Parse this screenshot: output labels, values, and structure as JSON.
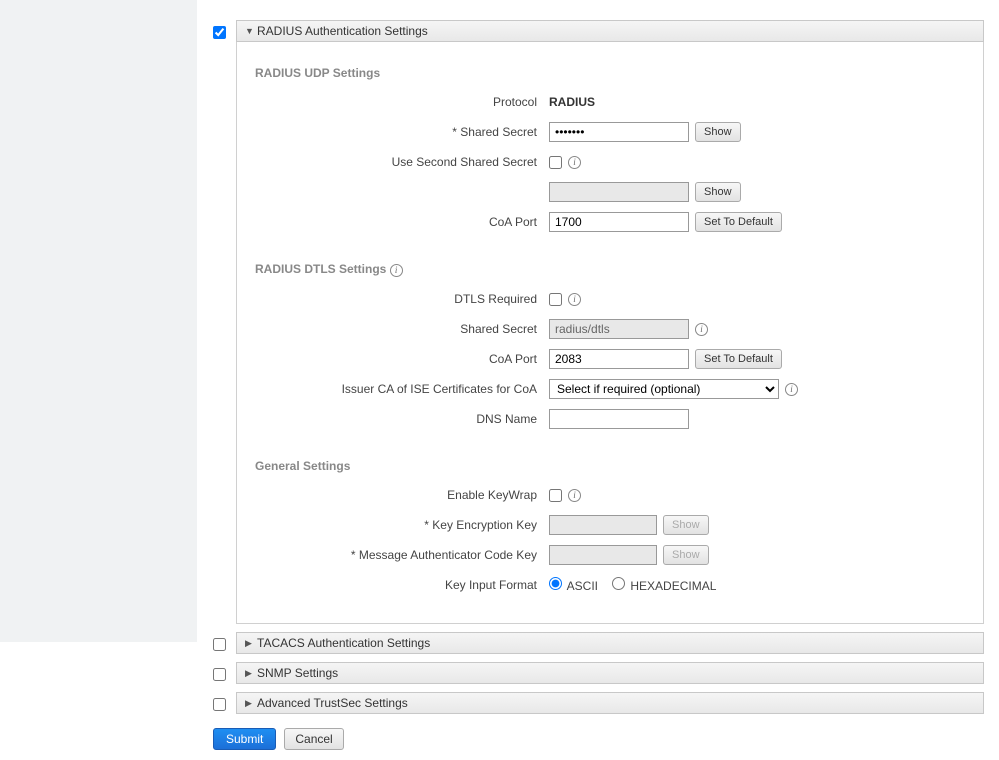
{
  "sections": {
    "radius": {
      "checked": true,
      "title": "RADIUS Authentication Settings",
      "groups": {
        "udp": {
          "title": "RADIUS UDP Settings",
          "protocol_label": "Protocol",
          "protocol_value": "RADIUS",
          "shared_secret_label": "* Shared Secret",
          "shared_secret_value": "•••••••",
          "show_btn": "Show",
          "use_second_label": "Use Second Shared Secret",
          "use_second_checked": false,
          "second_secret_value": "",
          "second_show_btn": "Show",
          "coa_port_label": "CoA Port",
          "coa_port_value": "1700",
          "set_default_btn": "Set To Default"
        },
        "dtls": {
          "title": "RADIUS DTLS Settings",
          "required_label": "DTLS Required",
          "required_checked": false,
          "shared_secret_label": "Shared Secret",
          "shared_secret_value": "radius/dtls",
          "coa_port_label": "CoA Port",
          "coa_port_value": "2083",
          "set_default_btn": "Set To Default",
          "issuer_ca_label": "Issuer CA of ISE Certificates for CoA",
          "issuer_ca_value": "Select if required (optional)",
          "dns_name_label": "DNS Name",
          "dns_name_value": ""
        },
        "general": {
          "title": "General Settings",
          "enable_keywrap_label": "Enable KeyWrap",
          "enable_keywrap_checked": false,
          "key_enc_label": "*  Key Encryption Key",
          "key_enc_value": "",
          "key_enc_show": "Show",
          "mac_key_label": "*  Message Authenticator Code Key",
          "mac_key_value": "",
          "mac_key_show": "Show",
          "key_format_label": "Key Input Format",
          "ascii": "ASCII",
          "hex": "HEXADECIMAL"
        }
      }
    },
    "tacacs": {
      "checked": false,
      "title": "TACACS Authentication Settings"
    },
    "snmp": {
      "checked": false,
      "title": "SNMP Settings"
    },
    "trustsec": {
      "checked": false,
      "title": "Advanced TrustSec Settings"
    }
  },
  "footer": {
    "submit": "Submit",
    "cancel": "Cancel"
  }
}
